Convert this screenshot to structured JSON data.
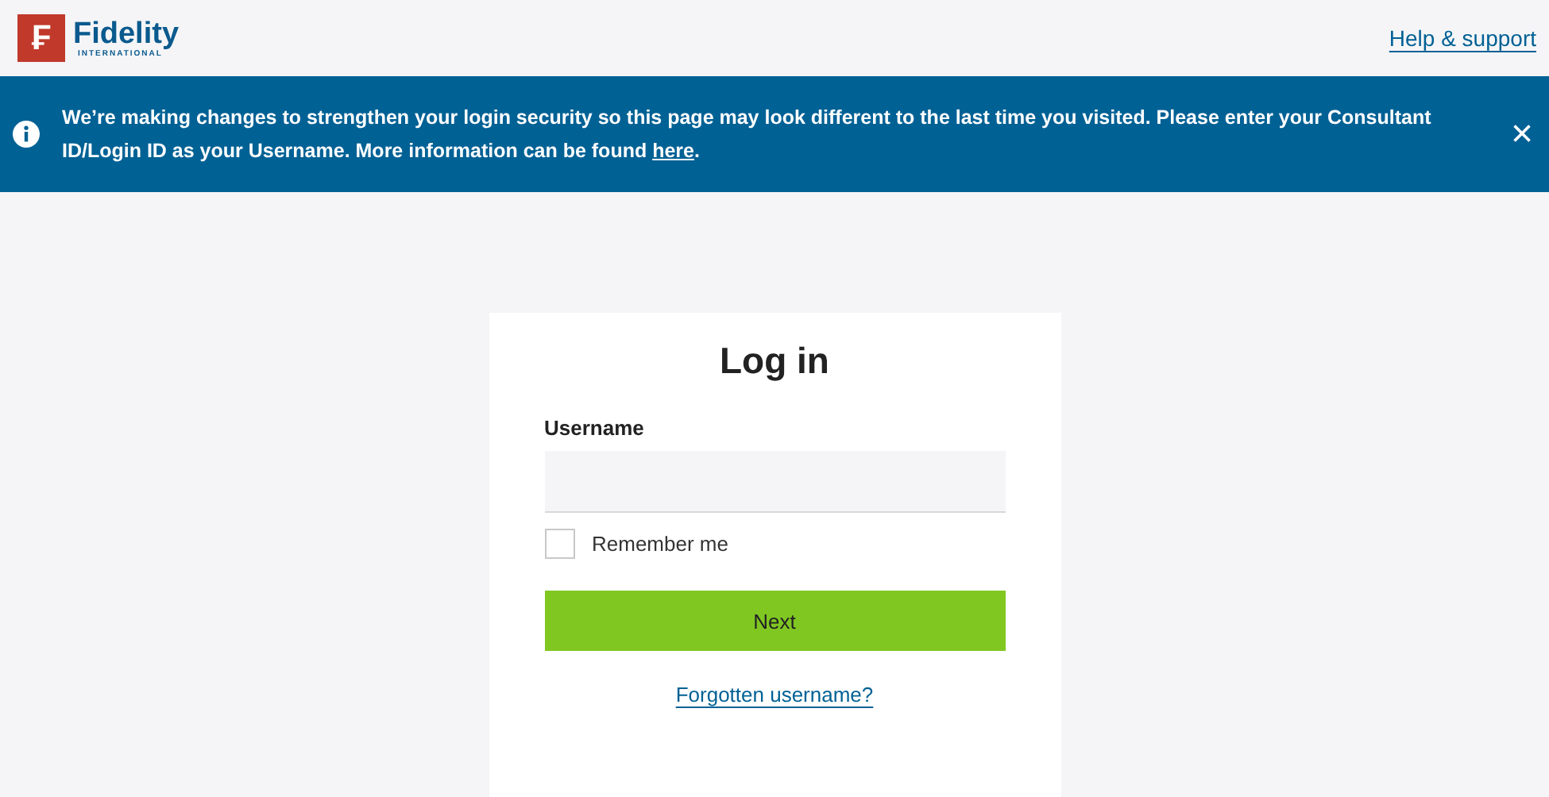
{
  "header": {
    "logo": {
      "mark": "₣",
      "name": "Fidelity",
      "subtitle": "INTERNATIONAL"
    },
    "help_link": "Help & support"
  },
  "banner": {
    "text_before": "We’re making changes to strengthen your login security so this page may look different to the last time you visited. Please enter your Consultant ID/Login ID as your Username. More information can be found ",
    "link": "here",
    "text_after": ".",
    "close": "×"
  },
  "login": {
    "title": "Log in",
    "username_label": "Username",
    "remember": {
      "label": "Remember me",
      "checked": false
    },
    "next_button": "Next",
    "forgot_link": "Forgotten username?"
  }
}
